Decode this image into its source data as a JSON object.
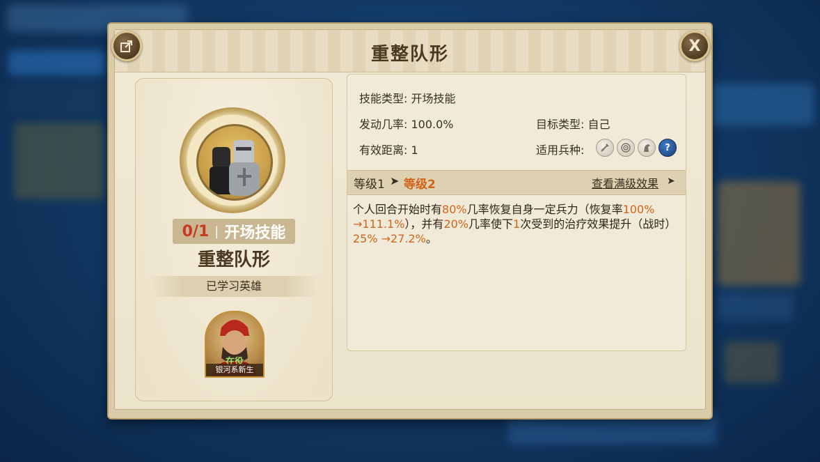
{
  "dialog": {
    "title": "重整队形",
    "close_label": "X"
  },
  "left": {
    "count": "0/1",
    "separator": "|",
    "type": "开场技能",
    "skill_name": "重整队形",
    "learned_label": "已学习英雄",
    "hero": {
      "status": "在役",
      "name": "银河系新生"
    }
  },
  "info": {
    "skill_type_label": "技能类型:",
    "skill_type_value": "开场技能",
    "rate_label": "发动几率:",
    "rate_value": "100.0%",
    "target_label": "目标类型:",
    "target_value": "自己",
    "range_label": "有效距离:",
    "range_value": "1",
    "troop_label": "适用兵种:",
    "troop_icons": [
      "sword-icon",
      "bow-target-icon",
      "horse-icon",
      "question-icon"
    ],
    "question_glyph": "?"
  },
  "level": {
    "from": "等级1",
    "arrow": "➤",
    "to": "等级2",
    "max_link": "查看满级效果",
    "max_arrow": "➤"
  },
  "description": {
    "p1": "个人回合开始时有",
    "h1": "80%",
    "p2": "几率恢复自身一定兵力（恢复率",
    "h2": "100% →111.1%",
    "p3": "），并有",
    "h3": "20%",
    "p4": "几率使下",
    "h4": "1",
    "p5": "次受到的治疗效果提升（战时）",
    "h5": "25% →27.2%",
    "p6": "。"
  },
  "colors": {
    "highlight": "#d0651a",
    "count_red": "#c73a1f",
    "title_brown": "#4a3820"
  }
}
